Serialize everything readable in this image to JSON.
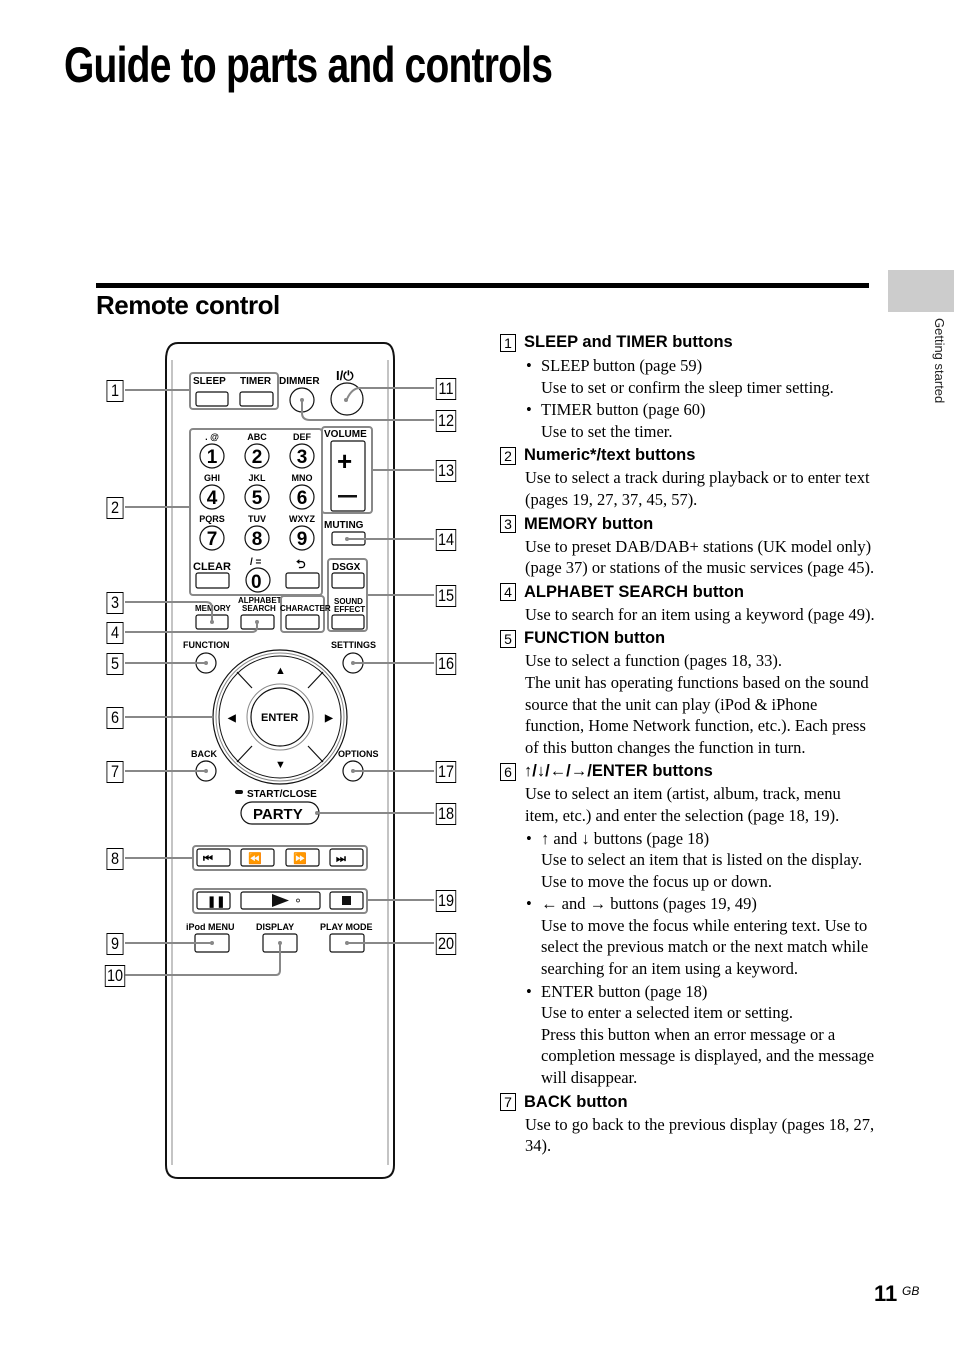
{
  "page": {
    "title": "Guide to parts and controls",
    "section_title": "Remote control",
    "side_tab_label": "Getting started",
    "page_number": "11",
    "page_suffix": "GB"
  },
  "remote": {
    "labels": {
      "sleep": "SLEEP",
      "timer": "TIMER",
      "dimmer": "DIMMER",
      "power": "I/⏻",
      "volume": "VOLUME",
      "muting": "MUTING",
      "dsgx": "DSGX",
      "clear": "CLEAR",
      "memory": "MEMORY",
      "alphabet_search_1": "ALPHABET",
      "alphabet_search_2": "SEARCH",
      "character": "CHARACTER",
      "sound_effect_1": "SOUND",
      "sound_effect_2": "EFFECT",
      "function": "FUNCTION",
      "settings": "SETTINGS",
      "enter": "ENTER",
      "back": "BACK",
      "options": "OPTIONS",
      "start_close": "START/CLOSE",
      "party": "PARTY",
      "ipod_menu": "iPod MENU",
      "display": "DISPLAY",
      "play_mode": "PLAY MODE",
      "zero_sub": "/ ="
    },
    "keypad": [
      {
        "digit": "1",
        "letters": ". @"
      },
      {
        "digit": "2",
        "letters": "ABC"
      },
      {
        "digit": "3",
        "letters": "DEF"
      },
      {
        "digit": "4",
        "letters": "GHI"
      },
      {
        "digit": "5",
        "letters": "JKL"
      },
      {
        "digit": "6",
        "letters": "MNO"
      },
      {
        "digit": "7",
        "letters": "PQRS"
      },
      {
        "digit": "8",
        "letters": "TUV"
      },
      {
        "digit": "9",
        "letters": "WXYZ"
      }
    ],
    "callouts": [
      "1",
      "2",
      "3",
      "4",
      "5",
      "6",
      "7",
      "8",
      "9",
      "10",
      "11",
      "12",
      "13",
      "14",
      "15",
      "16",
      "17",
      "18",
      "19",
      "20"
    ]
  },
  "descriptions": [
    {
      "num": "1",
      "heading": "SLEEP and TIMER buttons",
      "bullets": [
        {
          "title": "SLEEP button (page 59)",
          "text": "Use to set or confirm the sleep timer setting."
        },
        {
          "title": "TIMER button (page 60)",
          "text": "Use to set the timer."
        }
      ]
    },
    {
      "num": "2",
      "heading": "Numeric*/text buttons",
      "text": "Use to select a track during playback or to enter text (pages 19, 27, 37, 45, 57)."
    },
    {
      "num": "3",
      "heading": "MEMORY button",
      "text": "Use to preset DAB/DAB+ stations (UK model only) (page 37) or stations of the music services (page 45)."
    },
    {
      "num": "4",
      "heading": "ALPHABET SEARCH button",
      "text": "Use to search for an item using a keyword (page 49)."
    },
    {
      "num": "5",
      "heading": "FUNCTION button",
      "text": "Use to select a function (pages 18, 33).",
      "text2": "The unit has operating functions based on the sound source that the unit can play (iPod & iPhone function, Home Network function, etc.). Each press of this button changes the function in turn."
    },
    {
      "num": "6",
      "heading": "↑/↓/←/→/ENTER buttons",
      "text": "Use to select an item (artist, album, track, menu item, etc.) and enter the selection (page 18, 19).",
      "bullets": [
        {
          "title": "↑ and ↓ buttons (page 18)",
          "text": "Use to select an item that is listed on the display. Use to move the focus up or down."
        },
        {
          "title": "← and → buttons (pages 19, 49)",
          "text": "Use to move the focus while entering text. Use to select the previous match or the next match while searching for an item using a keyword."
        },
        {
          "title": "ENTER button (page 18)",
          "text": "Use to enter a selected item or setting.",
          "text2": "Press this button when an error message or a completion message is displayed, and the message will disappear."
        }
      ]
    },
    {
      "num": "7",
      "heading": "BACK button",
      "text": "Use to go back to the previous display (pages 18, 27, 34)."
    }
  ]
}
